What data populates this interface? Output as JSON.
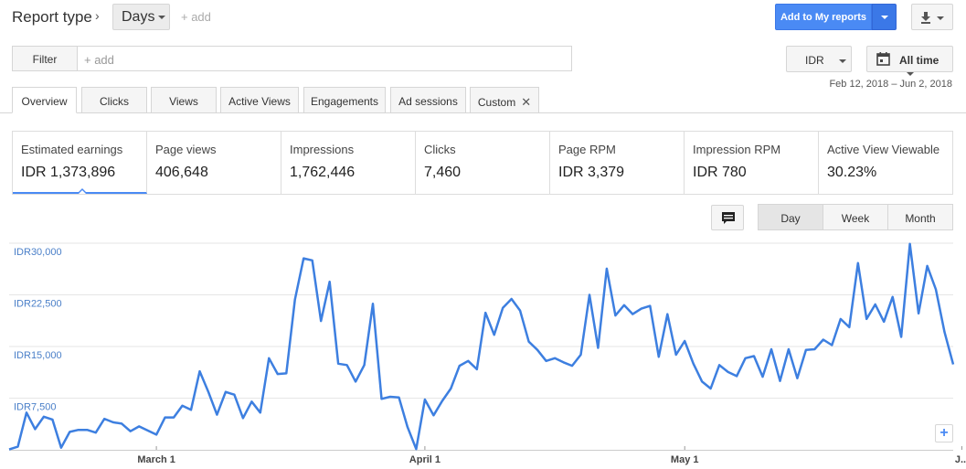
{
  "header": {
    "title": "Report type",
    "breadcrumb_chevron": "›",
    "days_label": "Days",
    "add_label": "+ add",
    "add_to_reports_label": "Add to My reports"
  },
  "filter": {
    "label": "Filter",
    "placeholder": "+ add"
  },
  "controls": {
    "currency": "IDR",
    "time_range": "All time",
    "date_range": "Feb 12, 2018 – Jun 2, 2018"
  },
  "tabs": [
    {
      "label": "Overview"
    },
    {
      "label": "Clicks"
    },
    {
      "label": "Views"
    },
    {
      "label": "Active Views"
    },
    {
      "label": "Engagements"
    },
    {
      "label": "Ad sessions"
    },
    {
      "label": "Custom"
    }
  ],
  "metrics": [
    {
      "label": "Estimated earnings",
      "value": "IDR 1,373,896"
    },
    {
      "label": "Page views",
      "value": "406,648"
    },
    {
      "label": "Impressions",
      "value": "1,762,446"
    },
    {
      "label": "Clicks",
      "value": "7,460"
    },
    {
      "label": "Page RPM",
      "value": "IDR 3,379"
    },
    {
      "label": "Impression RPM",
      "value": "IDR 780"
    },
    {
      "label": "Active View Viewable",
      "value": "30.23%"
    }
  ],
  "granularity": [
    {
      "label": "Day"
    },
    {
      "label": "Week"
    },
    {
      "label": "Month"
    }
  ],
  "colors": {
    "series": "#3d7fe0",
    "accent": "#4a8af4",
    "axis_label": "#4a7fc8"
  },
  "chart_data": {
    "type": "line",
    "y_ticks": [
      "IDR30,000",
      "IDR22,500",
      "IDR15,000",
      "IDR7,500"
    ],
    "ylim": [
      0,
      30000
    ],
    "x_labels": [
      {
        "label": "March 1",
        "index": 17
      },
      {
        "label": "April 1",
        "index": 48
      },
      {
        "label": "May 1",
        "index": 78
      },
      {
        "label": "J...",
        "index": 110
      }
    ],
    "grid": true,
    "series": [
      {
        "values": [
          50,
          450,
          5400,
          3000,
          4800,
          4400,
          300,
          2600,
          2900,
          2900,
          2500,
          4500,
          4000,
          3800,
          2700,
          3400,
          2800,
          2200,
          4700,
          4700,
          6400,
          5800,
          11400,
          8400,
          5100,
          8400,
          8000,
          4600,
          7000,
          5400,
          13300,
          11000,
          11100,
          21800,
          27800,
          27500,
          18700,
          24400,
          12500,
          12300,
          9900,
          12300,
          21200,
          7400,
          7700,
          7600,
          3300,
          100,
          7300,
          5000,
          7100,
          8900,
          12200,
          12900,
          11700,
          19900,
          16700,
          20600,
          21900,
          20200,
          15700,
          14500,
          12900,
          13300,
          12700,
          12200,
          13800,
          22500,
          14800,
          26300,
          19500,
          21000,
          19700,
          20500,
          20900,
          13500,
          19700,
          13800,
          15800,
          12500,
          9900,
          8900,
          12300,
          11300,
          10700,
          13300,
          13600,
          10600,
          14600,
          10000,
          14600,
          10400,
          14500,
          14600,
          16000,
          15200,
          19000,
          17800,
          27100,
          19000,
          21100,
          18600,
          22200,
          16400,
          29900,
          19800,
          26700,
          23300,
          17100,
          12400
        ]
      }
    ]
  }
}
